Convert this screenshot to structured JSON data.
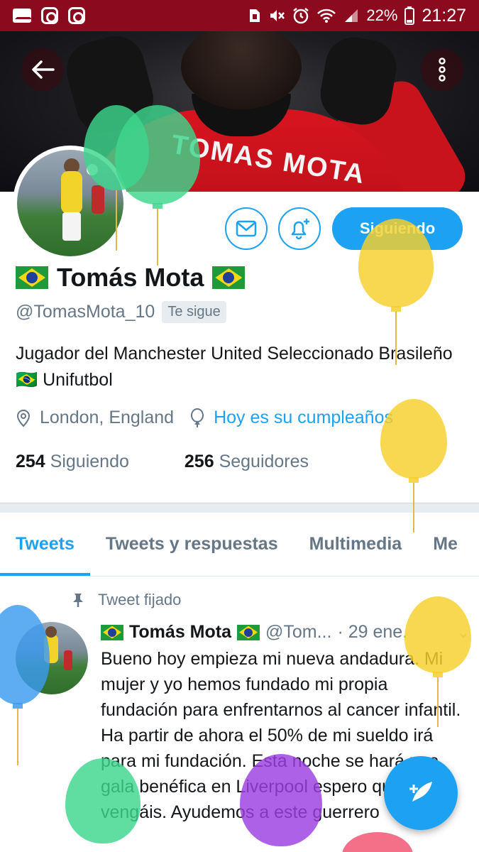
{
  "status_bar": {
    "battery": "22%",
    "time": "21:27",
    "left_icons": [
      "mail-icon",
      "instagram-icon",
      "instagram-icon"
    ],
    "right_icons": [
      "sim-icon",
      "mute-icon",
      "alarm-icon",
      "wifi-icon",
      "signal-icon",
      "battery-icon"
    ]
  },
  "header": {
    "banner_text": "TOMAS MOTA",
    "back_icon": "arrow-left-icon",
    "more_icon": "more-vertical-icon"
  },
  "actions": {
    "message_icon": "envelope-icon",
    "notify_icon": "bell-plus-icon",
    "follow_label": "Siguiendo"
  },
  "profile": {
    "name": "Tomás Mota",
    "handle": "@TomasMota_10",
    "follows_you": "Te sigue",
    "bio": "Jugador del Manchester United Seleccionado Brasileño 🇧🇷 Unifutbol",
    "location": "London, England",
    "birthday": "Hoy es su cumpleaños",
    "following_count": "254",
    "following_label": "Siguiendo",
    "followers_count": "256",
    "followers_label": "Seguidores"
  },
  "tabs": [
    {
      "label": "Tweets",
      "active": true
    },
    {
      "label": "Tweets y respuestas",
      "active": false
    },
    {
      "label": "Multimedia",
      "active": false
    },
    {
      "label": "Me",
      "active": false
    }
  ],
  "tweet": {
    "pinned_label": "Tweet fijado",
    "author_name": "Tomás Mota",
    "author_handle": "@Tom...",
    "date": "· 29 ene.",
    "text": "Bueno hoy empieza mi nueva andadura. Mi mujer y yo hemos fundado mi propia fundación para enfrentarnos al cancer infantil. Ha partir de ahora el 50% de mi sueldo irá para mi fundación. Esta noche se hará una gala benéfica en Liverpool espero que vengáis. Ayudemos a este guerrero"
  },
  "colors": {
    "status_bar": "#8b0a1e",
    "accent": "#1da1f2",
    "muted": "#657786",
    "balloon_green": "#3dd68c",
    "balloon_yellow": "#f7cf2a",
    "balloon_blue": "#3a9bf0",
    "balloon_purple": "#9b3ee0",
    "balloon_pink": "#f0506e"
  }
}
